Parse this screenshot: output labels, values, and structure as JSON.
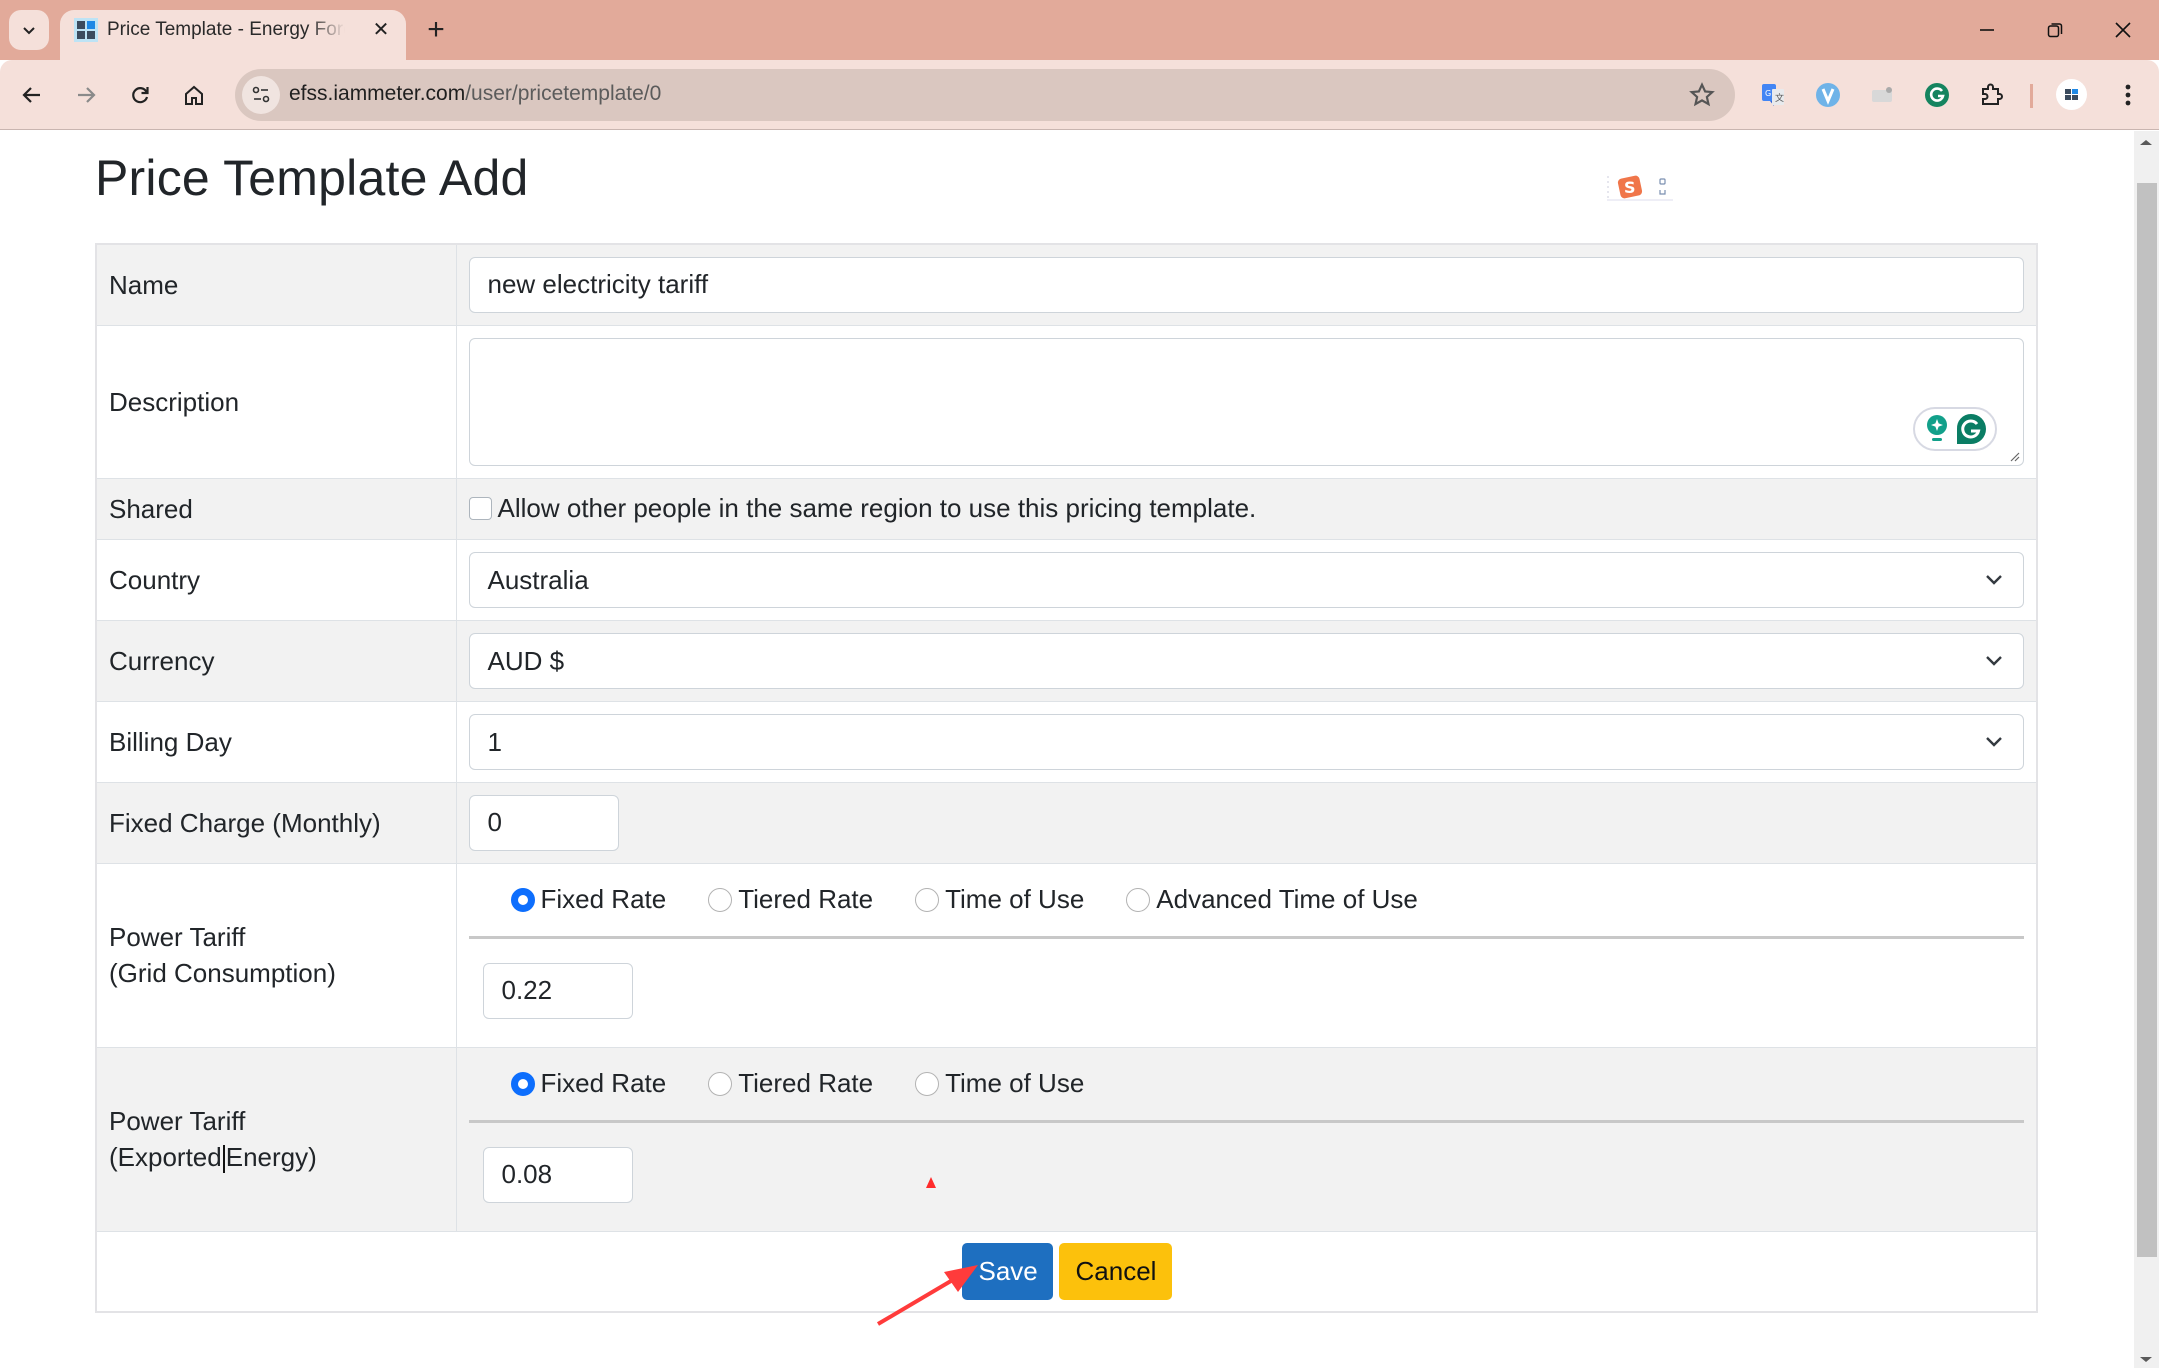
{
  "browser": {
    "tab_title": "Price Template - Energy Forecast",
    "url_host": "efss.iammeter.com",
    "url_path": "/user/pricetemplate/0",
    "extensions": [
      "google-translate-icon",
      "v-extension-icon",
      "screenshot-extension-icon",
      "grammarly-icon",
      "extensions-puzzle-icon"
    ],
    "window_controls": [
      "minimize",
      "restore",
      "close"
    ]
  },
  "page": {
    "title": "Price Template Add"
  },
  "form": {
    "name": {
      "label": "Name",
      "value": "new electricity tariff"
    },
    "description": {
      "label": "Description",
      "value": ""
    },
    "shared": {
      "label": "Shared",
      "checkbox_text": "Allow other people in the same region to use this pricing template.",
      "checked": false
    },
    "country": {
      "label": "Country",
      "selected": "Australia"
    },
    "currency": {
      "label": "Currency",
      "selected": "AUD $"
    },
    "billing_day": {
      "label": "Billing Day",
      "selected": "1"
    },
    "fixed_charge": {
      "label": "Fixed Charge (Monthly)",
      "value": "0"
    },
    "grid_tariff": {
      "label_line1": "Power Tariff",
      "label_line2": "(Grid Consumption)",
      "options": [
        "Fixed Rate",
        "Tiered Rate",
        "Time of Use",
        "Advanced Time of Use"
      ],
      "selected": "Fixed Rate",
      "value": "0.22"
    },
    "export_tariff": {
      "label_line1": "Power Tariff",
      "label_line2_a": "(Exported",
      "label_line2_b": "Energy)",
      "options": [
        "Fixed Rate",
        "Tiered Rate",
        "Time of Use"
      ],
      "selected": "Fixed Rate",
      "value": "0.08"
    }
  },
  "actions": {
    "save_label": "Save",
    "cancel_label": "Cancel"
  },
  "colors": {
    "save_button": "#1e6fc0",
    "cancel_button": "#fcc10c",
    "radio_checked": "#0d6efd",
    "annotation": "#ff2b2b",
    "chrome_frame": "#e2aa9a"
  }
}
